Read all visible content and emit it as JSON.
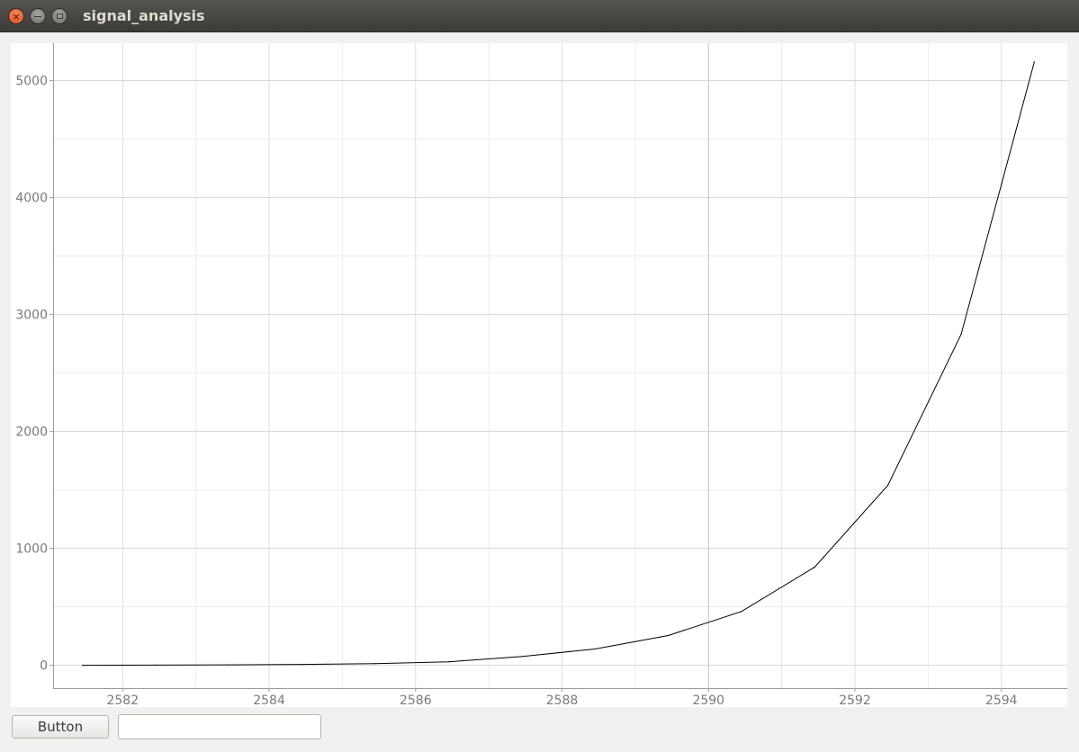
{
  "window": {
    "title": "signal_analysis",
    "controls": [
      "close-icon",
      "minimize-icon",
      "maximize-icon"
    ]
  },
  "chart_data": {
    "type": "line",
    "title": "",
    "xlabel": "",
    "ylabel": "",
    "xlim": [
      2581.05,
      2594.9
    ],
    "ylim": [
      -195,
      5320
    ],
    "x_ticks": [
      2582,
      2584,
      2586,
      2588,
      2590,
      2592,
      2594
    ],
    "y_ticks": [
      0,
      1000,
      2000,
      3000,
      4000,
      5000
    ],
    "grid": true,
    "line_color": "#000000",
    "series": [
      {
        "x": [
          2581.45,
          2582.45,
          2583.45,
          2584.45,
          2585.45,
          2586.45,
          2587.45,
          2588.45,
          2589.45,
          2590.45,
          2591.45,
          2592.45,
          2593.45,
          2594.45
        ],
        "y": [
          0,
          2,
          4,
          8,
          15,
          30,
          75,
          140,
          255,
          460,
          840,
          1540,
          2830,
          5160
        ]
      }
    ]
  },
  "controls": {
    "button_label": "Button",
    "input_value": "",
    "input_placeholder": ""
  }
}
